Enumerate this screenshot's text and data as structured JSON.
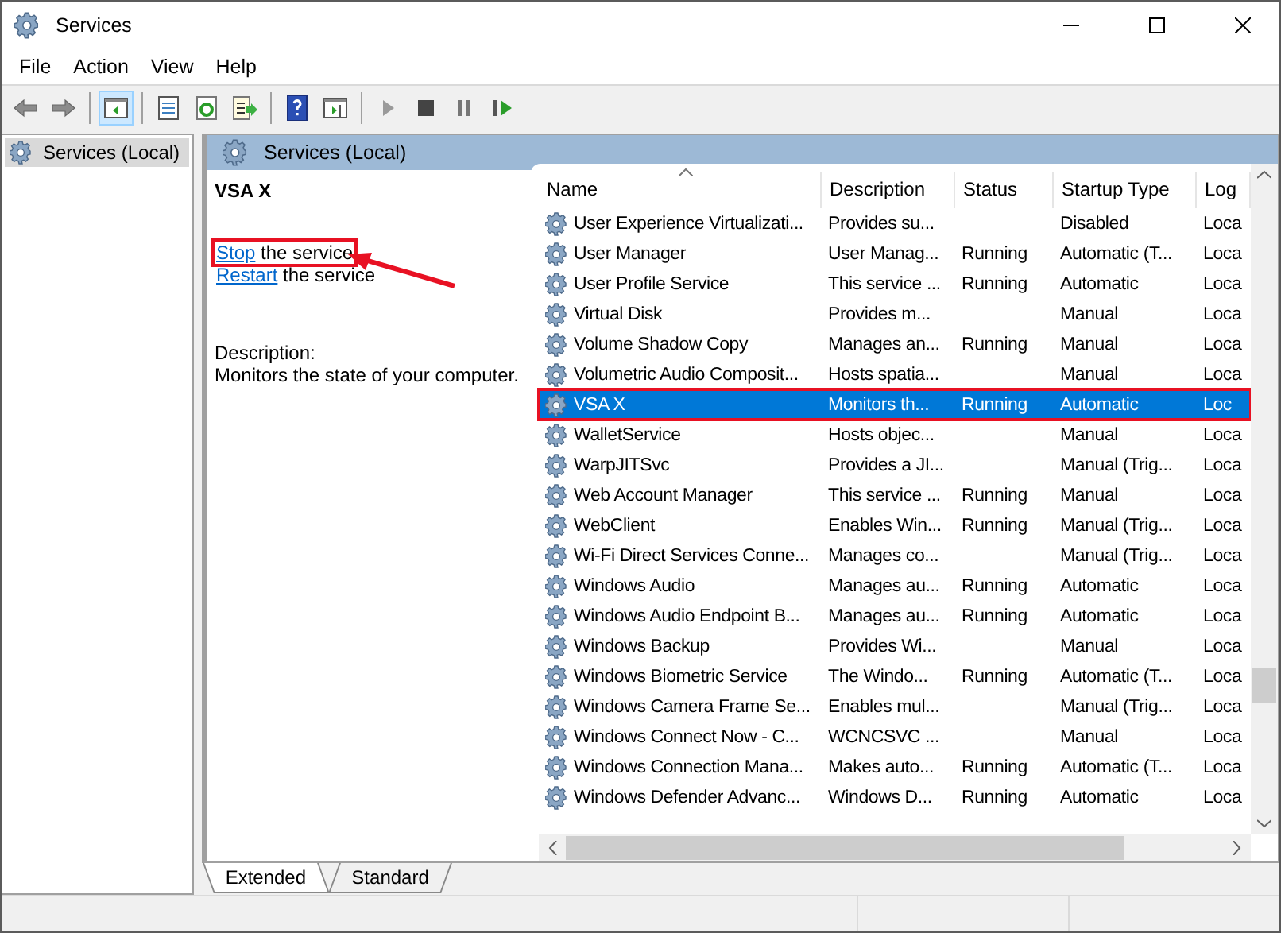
{
  "window": {
    "title": "Services"
  },
  "menu": [
    "File",
    "Action",
    "View",
    "Help"
  ],
  "toolbar": [
    {
      "kind": "back"
    },
    {
      "kind": "forward"
    },
    {
      "kind": "sep"
    },
    {
      "kind": "tree",
      "selected": true
    },
    {
      "kind": "sep"
    },
    {
      "kind": "properties"
    },
    {
      "kind": "refresh"
    },
    {
      "kind": "export"
    },
    {
      "kind": "sep"
    },
    {
      "kind": "help"
    },
    {
      "kind": "actionpane"
    },
    {
      "kind": "sep"
    },
    {
      "kind": "play"
    },
    {
      "kind": "stop"
    },
    {
      "kind": "pause"
    },
    {
      "kind": "resume"
    }
  ],
  "tree": {
    "items": [
      {
        "label": "Services (Local)",
        "selected": true
      }
    ]
  },
  "pane_header": "Services (Local)",
  "details": {
    "service_name": "VSA X",
    "actions": [
      {
        "link": "Stop",
        "rest": " the service",
        "annotated": true
      },
      {
        "link": "Restart",
        "rest": " the service",
        "annotated": false
      }
    ],
    "description_label": "Description:",
    "description": "Monitors the state of your computer."
  },
  "table": {
    "columns": [
      "Name",
      "Description",
      "Status",
      "Startup Type",
      "Log"
    ],
    "rows": [
      {
        "cells": [
          "User Experience Virtualizati...",
          "Provides su...",
          "",
          "Disabled",
          "Loca"
        ],
        "selected": false
      },
      {
        "cells": [
          "User Manager",
          "User Manag...",
          "Running",
          "Automatic (T...",
          "Loca"
        ],
        "selected": false
      },
      {
        "cells": [
          "User Profile Service",
          "This service ...",
          "Running",
          "Automatic",
          "Loca"
        ],
        "selected": false
      },
      {
        "cells": [
          "Virtual Disk",
          "Provides m...",
          "",
          "Manual",
          "Loca"
        ],
        "selected": false
      },
      {
        "cells": [
          "Volume Shadow Copy",
          "Manages an...",
          "Running",
          "Manual",
          "Loca"
        ],
        "selected": false
      },
      {
        "cells": [
          "Volumetric Audio Composit...",
          "Hosts spatia...",
          "",
          "Manual",
          "Loca"
        ],
        "selected": false
      },
      {
        "cells": [
          "VSA X",
          "Monitors th...",
          "Running",
          "Automatic",
          "Loc"
        ],
        "selected": true
      },
      {
        "cells": [
          "WalletService",
          "Hosts objec...",
          "",
          "Manual",
          "Loca"
        ],
        "selected": false
      },
      {
        "cells": [
          "WarpJITSvc",
          "Provides a JI...",
          "",
          "Manual (Trig...",
          "Loca"
        ],
        "selected": false
      },
      {
        "cells": [
          "Web Account Manager",
          "This service ...",
          "Running",
          "Manual",
          "Loca"
        ],
        "selected": false
      },
      {
        "cells": [
          "WebClient",
          "Enables Win...",
          "Running",
          "Manual (Trig...",
          "Loca"
        ],
        "selected": false
      },
      {
        "cells": [
          "Wi-Fi Direct Services Conne...",
          "Manages co...",
          "",
          "Manual (Trig...",
          "Loca"
        ],
        "selected": false
      },
      {
        "cells": [
          "Windows Audio",
          "Manages au...",
          "Running",
          "Automatic",
          "Loca"
        ],
        "selected": false
      },
      {
        "cells": [
          "Windows Audio Endpoint B...",
          "Manages au...",
          "Running",
          "Automatic",
          "Loca"
        ],
        "selected": false
      },
      {
        "cells": [
          "Windows Backup",
          "Provides Wi...",
          "",
          "Manual",
          "Loca"
        ],
        "selected": false
      },
      {
        "cells": [
          "Windows Biometric Service",
          "The Windo...",
          "Running",
          "Automatic (T...",
          "Loca"
        ],
        "selected": false
      },
      {
        "cells": [
          "Windows Camera Frame Se...",
          "Enables mul...",
          "",
          "Manual (Trig...",
          "Loca"
        ],
        "selected": false
      },
      {
        "cells": [
          "Windows Connect Now - C...",
          "WCNCSVC ...",
          "",
          "Manual",
          "Loca"
        ],
        "selected": false
      },
      {
        "cells": [
          "Windows Connection Mana...",
          "Makes auto...",
          "Running",
          "Automatic (T...",
          "Loca"
        ],
        "selected": false
      },
      {
        "cells": [
          "Windows Defender Advanc...",
          "Windows D...",
          "Running",
          "Automatic",
          "Loca"
        ],
        "selected": false
      }
    ]
  },
  "tabs": [
    {
      "label": "Extended",
      "selected": true
    },
    {
      "label": "Standard",
      "selected": false
    }
  ]
}
